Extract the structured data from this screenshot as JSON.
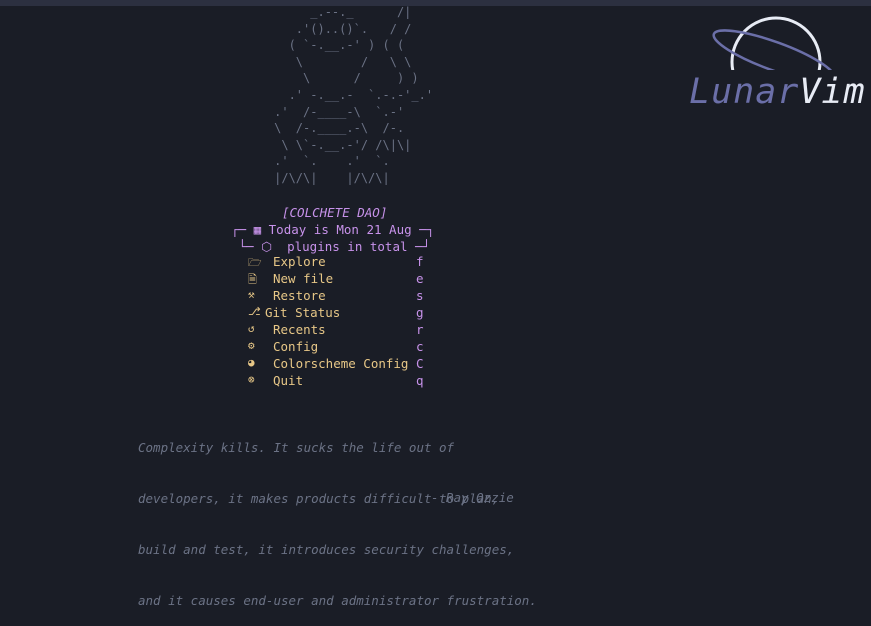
{
  "ascii_art": "          _.--._      /|\n        .'()..()`.   / /\n       ( `-.__.-' ) ( (\n        \\        /   \\ \\\n         \\      /     ) )\n       .' -.__.-  `.-.-'_.'\n     .'  /-____-\\  `.-'\n     \\  /-.____.-\\  /-.\n      \\ \\`-.__.-'/ /\\|\\|\n     .'  `.    .'  `.\n     |/\\/\\|    |/\\/\\|",
  "title": "[COLCHETE DAO]",
  "header": {
    "date_prefix": "┌─ ",
    "date_icon": "▦",
    "date_text": "Today is Mon 21 Aug",
    "date_suffix": " ─┐",
    "plugins_prefix": " └─ ",
    "plugins_icon": "⬡",
    "plugins_text": "plugins in total",
    "plugins_suffix": " ─┘"
  },
  "menu": [
    {
      "icon": "🗁",
      "label": "Explore",
      "key": "f",
      "name": "explore"
    },
    {
      "icon": "🗎",
      "label": "New file",
      "key": "e",
      "name": "new-file"
    },
    {
      "icon": "⚒",
      "label": "Restore",
      "key": "s",
      "name": "restore"
    },
    {
      "icon": "⎇",
      "label": "Git Status",
      "key": "g",
      "name": "git-status"
    },
    {
      "icon": "↺",
      "label": "Recents",
      "key": "r",
      "name": "recents"
    },
    {
      "icon": "⚙",
      "label": "Config",
      "key": "c",
      "name": "config"
    },
    {
      "icon": "◕",
      "label": "Colorscheme Config",
      "key": "C",
      "name": "colorscheme-config"
    },
    {
      "icon": "⊗",
      "label": "Quit",
      "key": "q",
      "name": "quit"
    }
  ],
  "quote": {
    "lines": [
      "Complexity kills. It sucks the life out of",
      "developers, it makes products difficult to plan,",
      "build and test, it introduces security challenges,",
      "and it causes end-user and administrator frustration."
    ],
    "author": "- Ray Ozzie"
  },
  "logo": {
    "part1": "Lunar",
    "part2": "Vim"
  },
  "colors": {
    "background": "#1a1d26",
    "accent": "#c792ea",
    "menu_text": "#e7c787",
    "muted": "#6b7285"
  }
}
